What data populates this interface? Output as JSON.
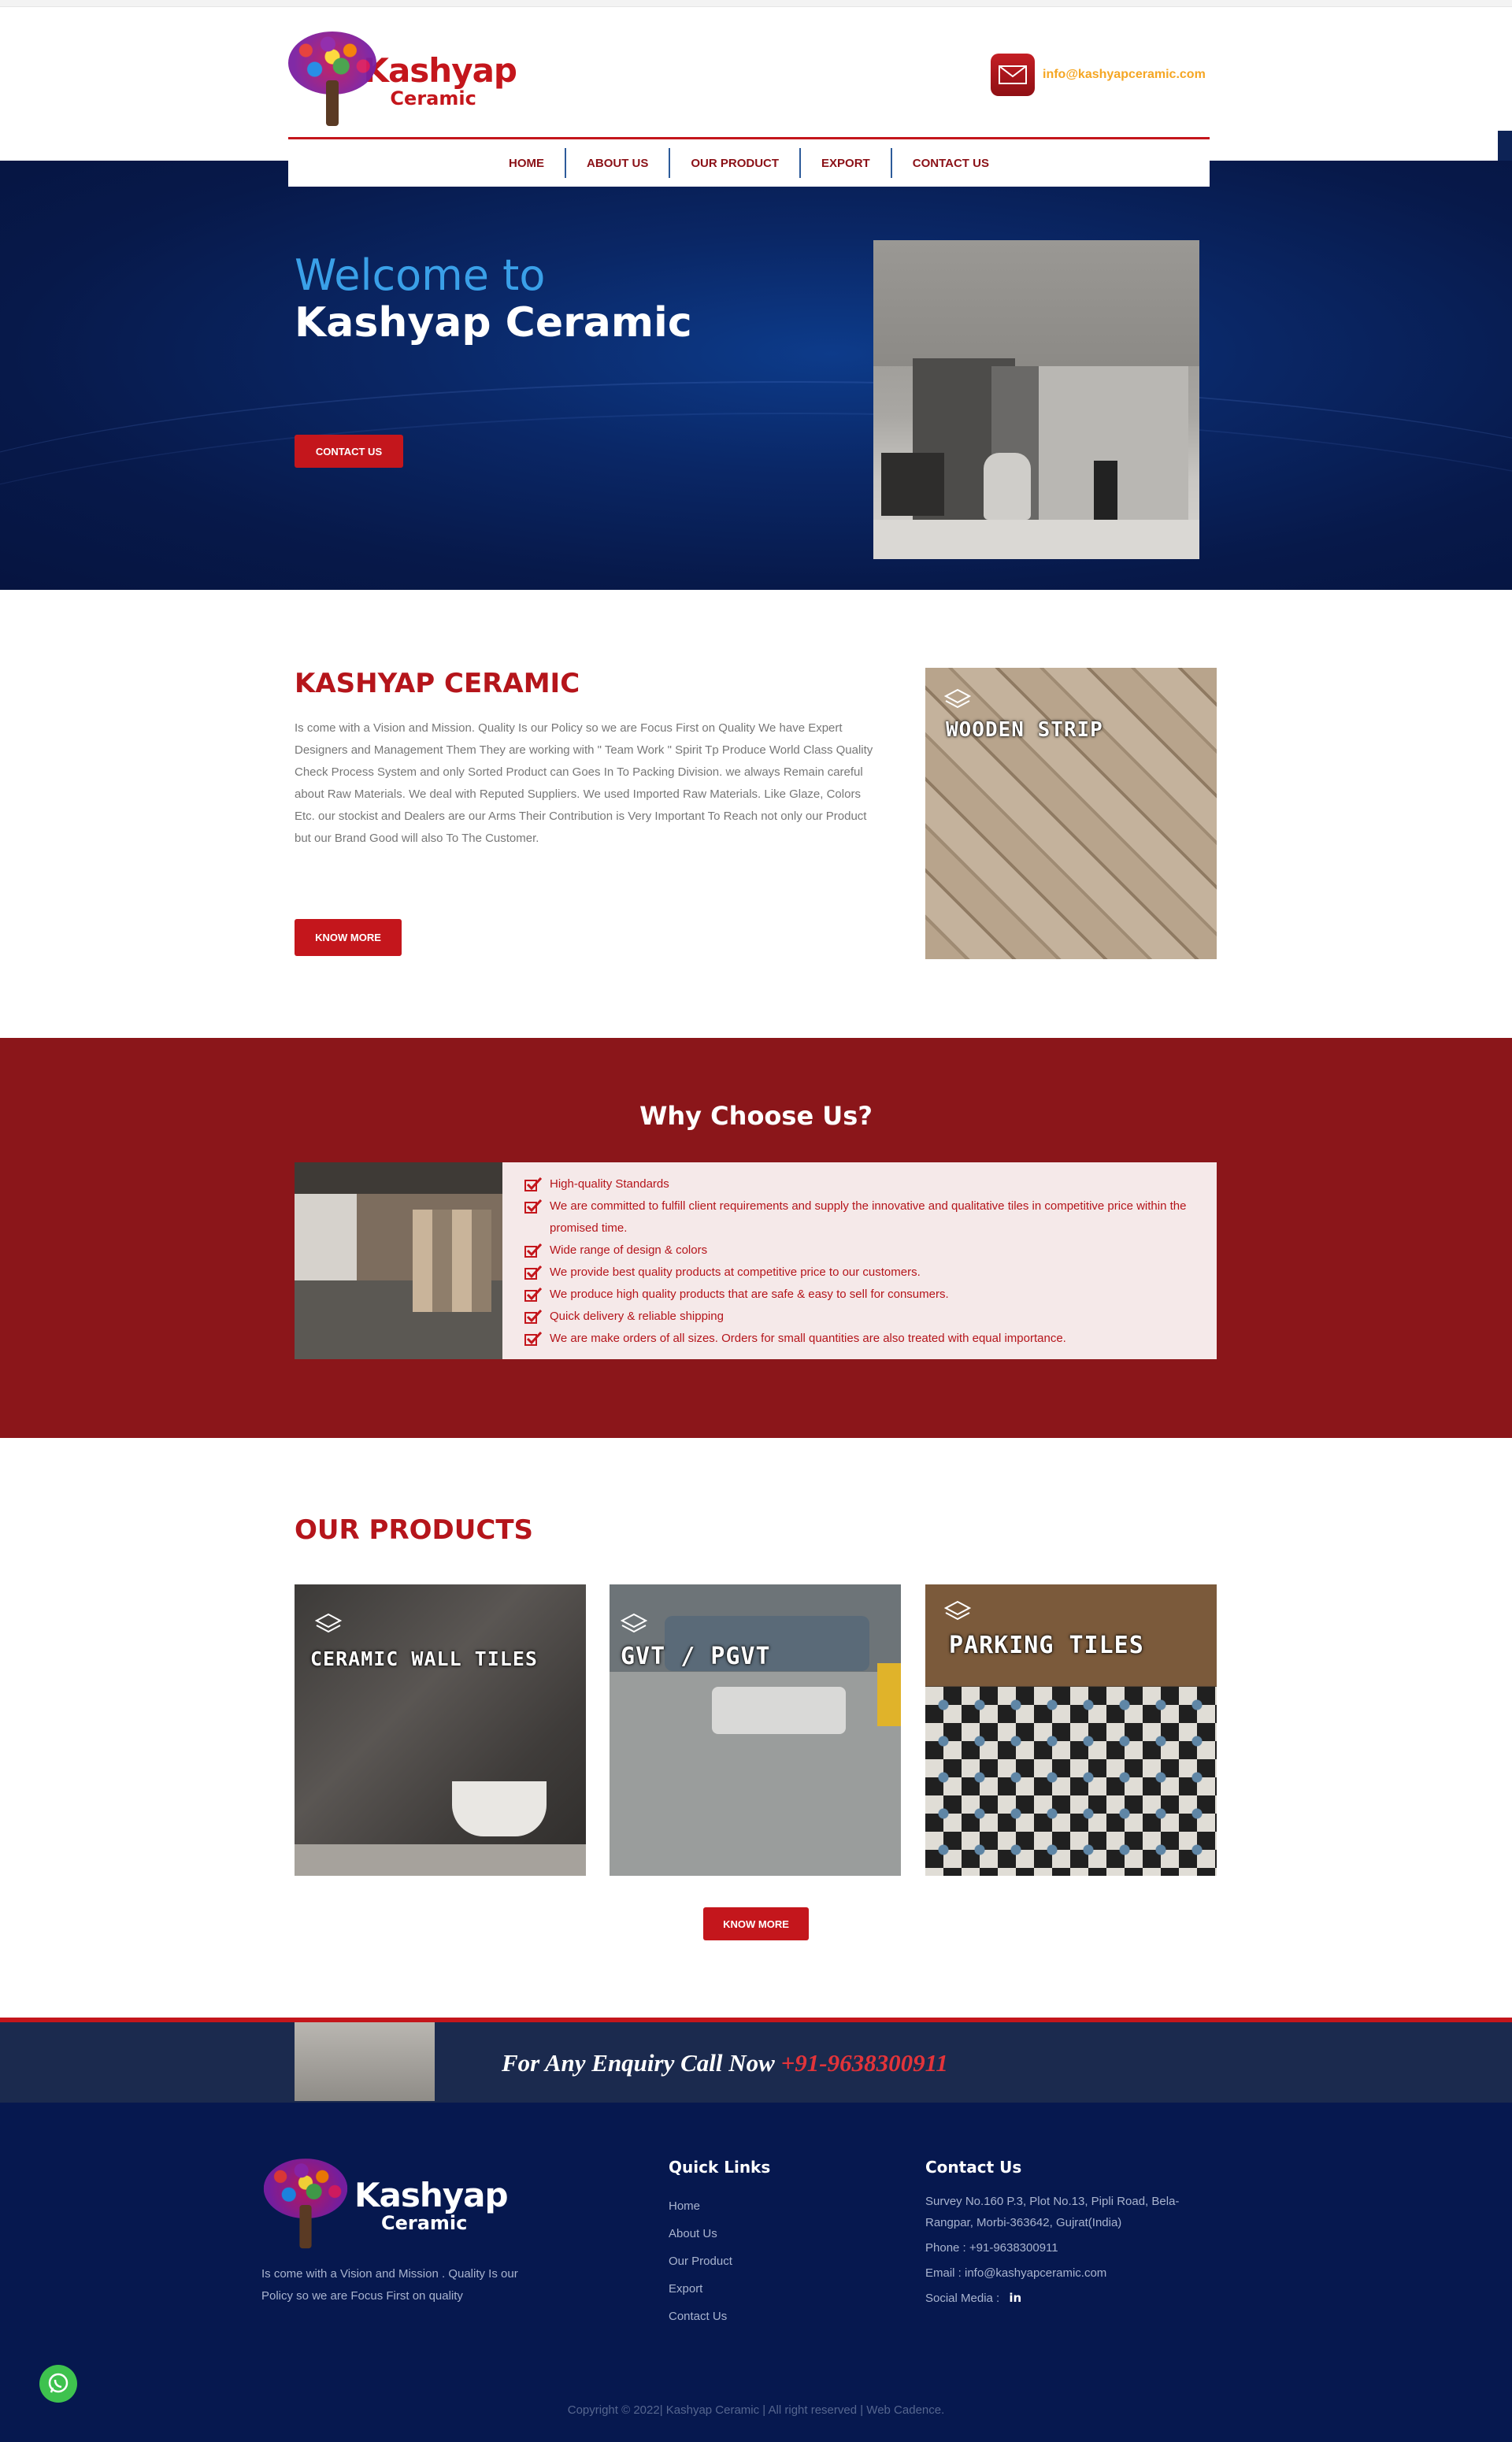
{
  "brand": {
    "name": "Kashyap",
    "sub": "Ceramic"
  },
  "header": {
    "email": "info@kashyapceramic.com"
  },
  "nav": {
    "items": [
      "HOME",
      "ABOUT US",
      "OUR PRODUCT",
      "EXPORT",
      "CONTACT US"
    ]
  },
  "hero": {
    "welcome": "Welcome to",
    "title": "Kashyap Ceramic",
    "button": "CONTACT US"
  },
  "about": {
    "title": "KASHYAP CERAMIC",
    "text": "Is come with a Vision and Mission. Quality Is our Policy so we are Focus First on Quality We have Expert Designers and Management Them They are working with \" Team Work \" Spirit Tp Produce World Class Quality Check Process System and only Sorted Product can Goes In To Packing Division. we always Remain careful about Raw Materials. We deal with Reputed Suppliers. We used Imported Raw Materials. Like Glaze, Colors Etc. our stockist and Dealers are our Arms Their Contribution is Very Important To Reach not only our Product but our Brand Good will also To The Customer.",
    "button": "KNOW MORE",
    "feature_label": "WOODEN STRIP"
  },
  "why": {
    "title": "Why Choose Us?",
    "items": [
      "High-quality Standards",
      "We are committed to fulfill client requirements and supply the innovative and qualitative tiles in competitive price within the promised time.",
      "Wide range of design & colors",
      "We provide best quality products at competitive price to our customers.",
      "We produce high quality products that are safe & easy to sell for consumers.",
      "Quick delivery & reliable shipping",
      "We are make orders of all sizes. Orders for small quantities are also treated with equal importance."
    ]
  },
  "products": {
    "title": "OUR PRODUCTS",
    "items": [
      "CERAMIC WALL TILES",
      "GVT / PGVT",
      "PARKING TILES"
    ],
    "button": "KNOW MORE"
  },
  "enquiry": {
    "text": "For Any Enquiry Call Now",
    "phone": "+91-9638300911"
  },
  "footer": {
    "about": "Is come with a Vision and Mission . Quality Is our Policy so we are Focus First on quality",
    "quick_links_title": "Quick Links",
    "links": [
      "Home",
      "About Us",
      "Our Product",
      "Export",
      "Contact Us"
    ],
    "contact_title": "Contact Us",
    "address": "Survey No.160 P.3, Plot No.13, Pipli Road, Bela-Rangpar, Morbi-363642, Gujrat(India)",
    "phone": "Phone : +91-9638300911",
    "email": "Email : info@kashyapceramic.com",
    "social_label": "Social Media :",
    "social_icon": "linkedin-icon",
    "copyright": "Copyright © 2022| Kashyap Ceramic | All right reserved | Web Cadence."
  },
  "colors": {
    "brand_red": "#c4161c",
    "dark_red": "#8b161a",
    "navy": "#06184f",
    "accent_blue": "#3aa0e8",
    "email_orange": "#f5a623"
  }
}
